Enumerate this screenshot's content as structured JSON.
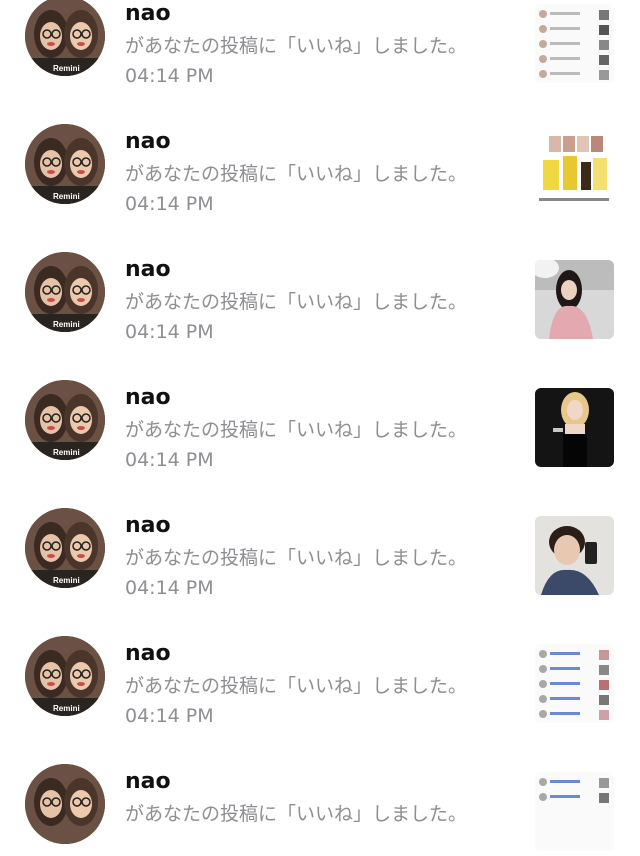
{
  "notifications": [
    {
      "username": "",
      "message": "",
      "time": "",
      "thumbnail": "cut-off-row"
    },
    {
      "username": "nao",
      "message": "があなたの投稿に「いいね」しました。",
      "time": "04:14 PM",
      "thumbnail": "notification-list-screenshot"
    },
    {
      "username": "nao",
      "message": "があなたの投稿に「いいね」しました。",
      "time": "04:14 PM",
      "thumbnail": "cosmetics-product-photo"
    },
    {
      "username": "nao",
      "message": "があなたの投稿に「いいね」しました。",
      "time": "04:14 PM",
      "thumbnail": "woman-in-pink-coat-photo"
    },
    {
      "username": "nao",
      "message": "があなたの投稿に「いいね」しました。",
      "time": "04:14 PM",
      "thumbnail": "woman-in-black-outfit-photo"
    },
    {
      "username": "nao",
      "message": "があなたの投稿に「いいね」しました。",
      "time": "04:14 PM",
      "thumbnail": "man-mirror-selfie-photo"
    },
    {
      "username": "nao",
      "message": "があなたの投稿に「いいね」しました。",
      "time": "04:14 PM",
      "thumbnail": "notification-list-screenshot"
    },
    {
      "username": "nao",
      "message": "があなたの投稿に「いいね」しました。",
      "time": "",
      "thumbnail": "notification-list-screenshot"
    }
  ],
  "avatar_watermark": "Remini",
  "colors": {
    "username": "#111111",
    "secondary_text": "#8e8e93",
    "background": "#ffffff"
  }
}
